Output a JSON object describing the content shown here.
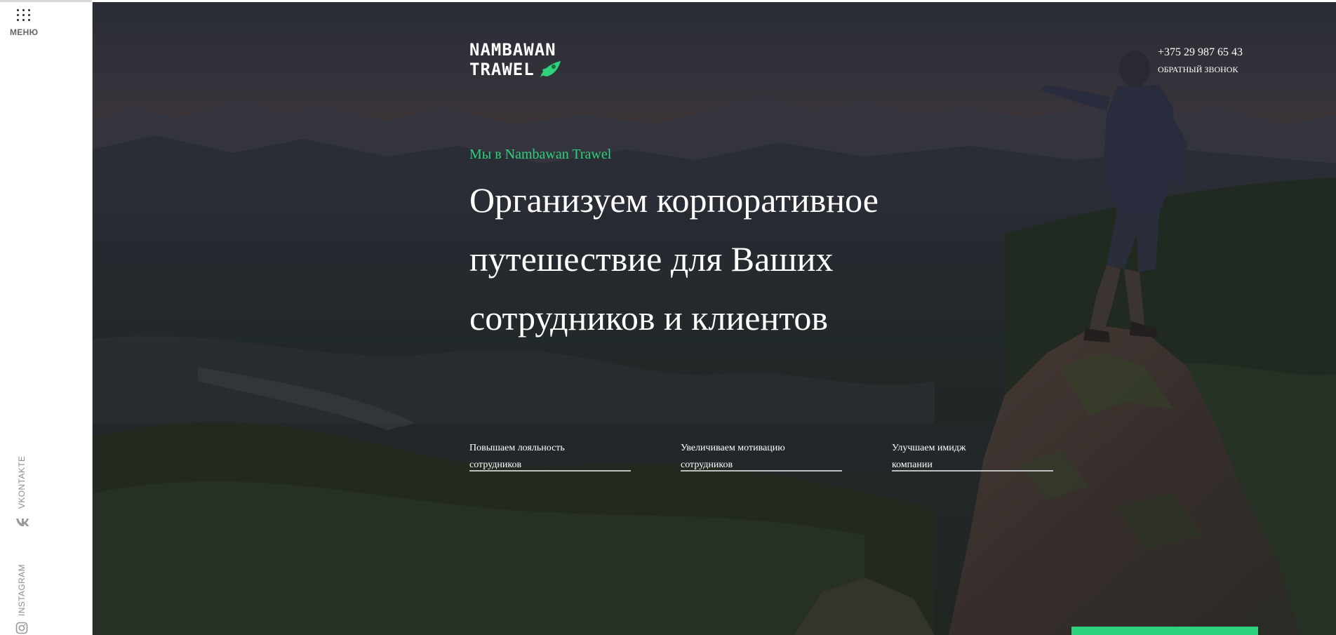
{
  "sidebar": {
    "menu_label": "МЕНЮ",
    "menu_icon": "grid-dots-icon",
    "social": [
      {
        "label": "VKONTAKTE",
        "icon": "vk-icon"
      },
      {
        "label": "INSTAGRAM",
        "icon": "instagram-icon"
      }
    ]
  },
  "header": {
    "logo": {
      "line1": "NAMBAWAN",
      "line2": "TRAWEL",
      "icon": "rocket-icon"
    },
    "phone": "+375 29 987 65 43",
    "callback_label": "ОБРАТНЫЙ ЗВОНОК"
  },
  "hero": {
    "eyebrow": "Мы в Nambawan Trawel",
    "headline_lines": [
      "Организуем корпоративное",
      "путешествие для Ваших",
      "сотрудников и клиентов"
    ],
    "features": [
      {
        "line1": "Повышаем лояльность",
        "line2": "сотрудников"
      },
      {
        "line1": "Увеличиваем мотивацию",
        "line2": "сотрудников"
      },
      {
        "line1": "Улучшаем имидж",
        "line2": "компании"
      }
    ]
  },
  "colors": {
    "accent": "#2ed17c",
    "overlay": "#14161c",
    "text_light": "#ffffff",
    "sidebar_text": "#8d8d8d"
  }
}
